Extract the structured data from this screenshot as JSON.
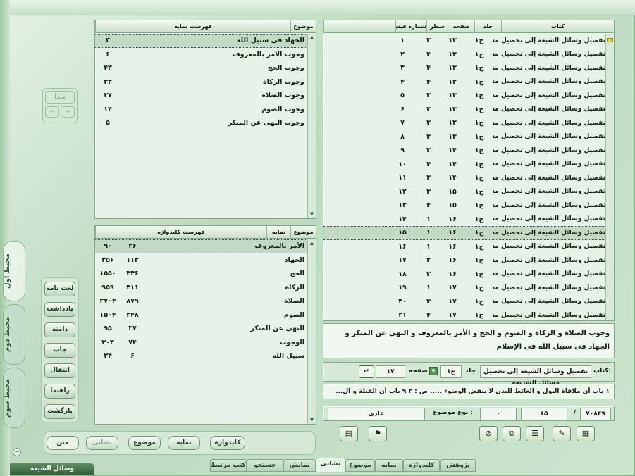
{
  "app_title": "وسائل الشیعه",
  "left_vtabs": [
    "محیط اول",
    "محیط دوم",
    "محیط سوم"
  ],
  "side_buttons": {
    "start": "مبدأ",
    "items": [
      "لغت نامه",
      "یادداشت",
      "دامنه",
      "چاپ",
      "انتقال",
      "راهنما",
      "بازگشت"
    ]
  },
  "bottom_toolbar": [
    "متن",
    "نشانی",
    "موضوع",
    "نمایه",
    "کلیدواژه"
  ],
  "bottom_tabs": [
    "پژوهش",
    "کلیدواژه",
    "نمایه",
    "موضوع",
    "نشانی",
    "نمایش",
    "جستجو",
    "کتب مرتبط"
  ],
  "active_tab": "نشانی",
  "index_list": {
    "headers": [
      "فهرست نمایه",
      "موضوع"
    ],
    "rows": [
      {
        "title": "الجهاد فی سبیل الله",
        "count": "۳"
      },
      {
        "title": "وجوب الأمر بالمعروف",
        "count": "۶"
      },
      {
        "title": "وجوب الحج",
        "count": "۴۳"
      },
      {
        "title": "وجوب الزکاة",
        "count": "۳۳"
      },
      {
        "title": "وجوب الصلاة",
        "count": "۳۷"
      },
      {
        "title": "وجوب الصوم",
        "count": "۱۴"
      },
      {
        "title": "وجوب النهی عن المنکر",
        "count": "۵"
      }
    ]
  },
  "keyword_list": {
    "headers": [
      "فهرست کلیدواژه",
      "نمایه",
      "موضوع"
    ],
    "rows": [
      {
        "word": "الأمر بالمعروف",
        "index": "۳۶",
        "topic": "۹۰"
      },
      {
        "word": "الجهاد",
        "index": "۱۱۳",
        "topic": "۳۵۶"
      },
      {
        "word": "الحج",
        "index": "۳۳۶",
        "topic": "۱۵۵۰"
      },
      {
        "word": "الزکاة",
        "index": "۳۱۱",
        "topic": "۹۵۹"
      },
      {
        "word": "الصلاة",
        "index": "۸۷۹",
        "topic": "۳۷۰۴"
      },
      {
        "word": "الصوم",
        "index": "۳۴۸",
        "topic": "۱۵۰۴"
      },
      {
        "word": "النهی عن المنکر",
        "index": "۳۷",
        "topic": "۹۵"
      },
      {
        "word": "الوجوب",
        "index": "۷۴",
        "topic": "۳۰۳"
      },
      {
        "word": "سبیل الله",
        "index": "۶",
        "topic": "۳۴"
      }
    ]
  },
  "address_grid": {
    "headers": [
      "کتاب",
      "جلد",
      "صفحه",
      "سطر",
      "شماره فیش"
    ],
    "book": "تفصیل وسائل الشیعة إلی تحصیل مسائل الشریعة",
    "rows": [
      {
        "vol": "ج۱",
        "page": "۱۳",
        "line": "۳",
        "fish": "۱"
      },
      {
        "vol": "ج۱",
        "page": "۱۳",
        "line": "۴",
        "fish": "۲"
      },
      {
        "vol": "ج۱",
        "page": "۱۳",
        "line": "۴",
        "fish": "۳"
      },
      {
        "vol": "ج۱",
        "page": "۱۳",
        "line": "۴",
        "fish": "۴"
      },
      {
        "vol": "ج۱",
        "page": "۱۳",
        "line": "۳",
        "fish": "۵"
      },
      {
        "vol": "ج۱",
        "page": "۱۳",
        "line": "۳",
        "fish": "۶"
      },
      {
        "vol": "ج۱",
        "page": "۱۳",
        "line": "۳",
        "fish": "۷"
      },
      {
        "vol": "ج۱",
        "page": "۱۳",
        "line": "۳",
        "fish": "۸"
      },
      {
        "vol": "ج۱",
        "page": "۱۴",
        "line": "۳",
        "fish": "۹"
      },
      {
        "vol": "ج۱",
        "page": "۱۴",
        "line": "۴",
        "fish": "۱۰"
      },
      {
        "vol": "ج۱",
        "page": "۱۴",
        "line": "۳",
        "fish": "۱۱"
      },
      {
        "vol": "ج۱",
        "page": "۱۵",
        "line": "۳",
        "fish": "۱۲"
      },
      {
        "vol": "ج۱",
        "page": "۱۵",
        "line": "۴",
        "fish": "۱۳"
      },
      {
        "vol": "ج۱",
        "page": "۱۶",
        "line": "۱",
        "fish": "۱۴"
      },
      {
        "vol": "ج۱",
        "page": "۱۶",
        "line": "۱",
        "fish": "۱۵"
      },
      {
        "vol": "ج۱",
        "page": "۱۶",
        "line": "۱",
        "fish": "۱۶"
      },
      {
        "vol": "ج۱",
        "page": "۱۶",
        "line": "۳",
        "fish": "۱۷"
      },
      {
        "vol": "ج۱",
        "page": "۱۶",
        "line": "۳",
        "fish": "۱۸"
      },
      {
        "vol": "ج۱",
        "page": "۱۷",
        "line": "۱",
        "fish": "۱۹"
      },
      {
        "vol": "ج۱",
        "page": "۱۷",
        "line": "۳",
        "fish": "۳۰"
      },
      {
        "vol": "ج۱",
        "page": "۱۷",
        "line": "۴",
        "fish": "۳۱"
      }
    ],
    "selected_index": 14
  },
  "description": "وجوب الصلاة و الزکاة و الصوم و الحج و الأمر بالمعروف و النهی عن المنکر و الجهاد فی سبیل الله فی الإسلام",
  "nav_bar": {
    "book_label": "کتاب:",
    "book_value": "تفصیل وسائل الشیعة إلی تحصیل مسائل الشریعة",
    "vol_label": "جلد",
    "vol_value": "ج۱",
    "page_label": "صفحه",
    "page_value": "۱۷"
  },
  "chapter_line": "۱ باب أن ملاقاة البول و الغائط للبدن لا ینقض الوضوء ..... ص : ۳  ۹ باب أن القبلة و ال...",
  "topic_type_label": "نوع موضوع :",
  "topic_type_value": "عادی",
  "counter": {
    "total": "۷۰۸۴۹",
    "sep": "/",
    "current": "۶۵",
    "zero": "۰"
  }
}
